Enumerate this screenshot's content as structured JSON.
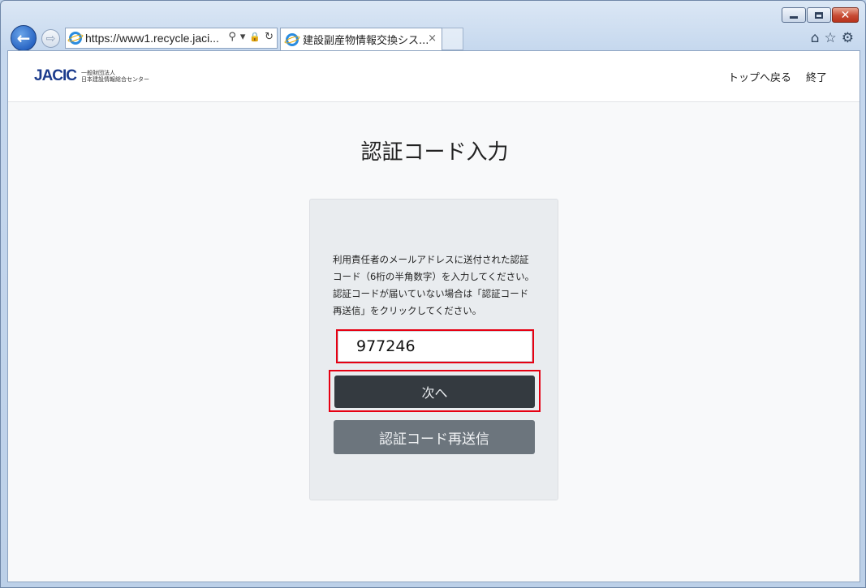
{
  "browser": {
    "address": "https://www1.recycle.jaci...",
    "tab_title": "建設副産物情報交換シス...",
    "tab_close": "×",
    "back_glyph": "←",
    "forward_glyph": "⇨",
    "addr_icons": {
      "search": "⚲",
      "dropdown": "▾",
      "lock": "🔒",
      "refresh": "↻"
    },
    "tools": {
      "home": "⌂",
      "favorites": "☆",
      "settings": "⚙"
    },
    "caption": {
      "close": "✕"
    }
  },
  "header": {
    "logo_mark": "JACIC",
    "logo_line1": "一般財団法人",
    "logo_line2": "日本建設情報総合センター",
    "nav": {
      "top": "トップへ戻る",
      "exit": "終了"
    }
  },
  "main": {
    "title": "認証コード入力",
    "instructions": "利用責任者のメールアドレスに送付された認証コード（6桁の半角数字）を入力してください。認証コードが届いていない場合は「認証コード再送信」をクリックしてください。",
    "code_value": "977246",
    "next_label": "次へ",
    "resend_label": "認証コード再送信"
  }
}
